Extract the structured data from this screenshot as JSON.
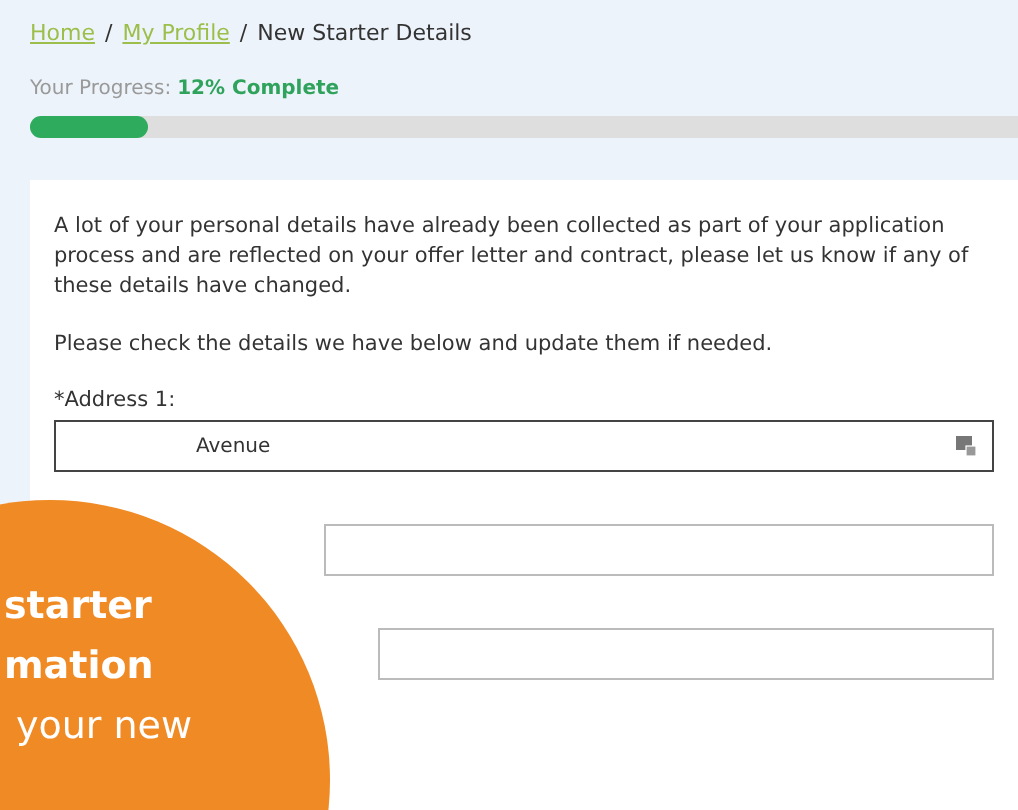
{
  "breadcrumb": {
    "links": [
      "Home",
      "My Profile"
    ],
    "current": "New Starter Details",
    "separator": "/"
  },
  "progress": {
    "label": "Your Progress:",
    "value": "12% Complete",
    "level": 0.12
  },
  "intro": "A lot of your personal details have already been collected as part of your application process and are reflected on your offer letter and contract, please let us know if any of these details have changed.",
  "instruction": "Please check the details we have below and update them if needed.",
  "fields": [
    {
      "kind": "text",
      "label": "*Address 1:",
      "value": "Avenue"
    },
    {
      "kind": "text"
    },
    {
      "kind": "text"
    }
  ],
  "promo": {
    "lines": [
      "starter",
      "mation",
      "your new"
    ]
  }
}
